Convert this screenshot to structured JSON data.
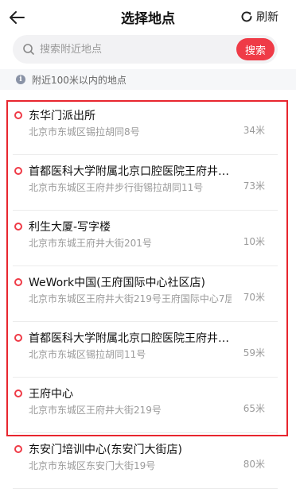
{
  "header": {
    "title": "选择地点",
    "refresh_label": "刷新"
  },
  "search": {
    "placeholder": "搜索附近地点",
    "button_label": "搜索"
  },
  "hint": {
    "icon": "i",
    "text": "附近100米以内的地点"
  },
  "places": [
    {
      "name": "东华门派出所",
      "address": "北京市东城区锡拉胡同8号",
      "distance": "34米"
    },
    {
      "name": "首都医科大学附属北京口腔医院王府井…",
      "address": "北京市东城区王府井步行街锡拉胡同11号",
      "distance": "73米"
    },
    {
      "name": "利生大厦-写字楼",
      "address": "北京市东城王府井大街201号",
      "distance": "10米"
    },
    {
      "name": "WeWork中国(王府国际中心社区店)",
      "address": "北京市东城区王府井大街219号王府国际中心7层",
      "distance": "70米"
    },
    {
      "name": "首都医科大学附属北京口腔医院王府井…",
      "address": "北京市东城区锡拉胡同11号",
      "distance": "59米"
    },
    {
      "name": "王府中心",
      "address": "北京市东城区王府井大街219号",
      "distance": "65米"
    },
    {
      "name": "东安门培训中心(东安门大街店)",
      "address": "北京市东城区东安门大街19号",
      "distance": "80米"
    }
  ],
  "colors": {
    "accent": "#ef3b47",
    "highlight_border": "#e8262f"
  }
}
